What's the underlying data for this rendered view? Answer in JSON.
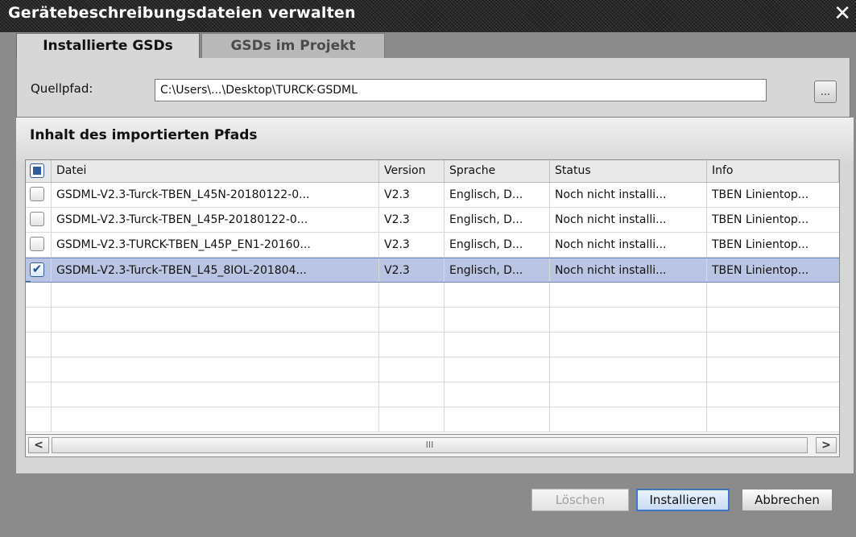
{
  "window": {
    "title": "Gerätebeschreibungsdateien verwalten",
    "close_glyph": "✕"
  },
  "tabs": [
    {
      "label": "Installierte GSDs",
      "active": true
    },
    {
      "label": "GSDs im Projekt",
      "active": false
    }
  ],
  "source": {
    "label": "Quellpfad:",
    "value": "C:\\Users\\...\\Desktop\\TURCK-GSDML",
    "browse_label": "..."
  },
  "section_title": "Inhalt des importierten Pfads",
  "table": {
    "columns": [
      "Datei",
      "Version",
      "Sprache",
      "Status",
      "Info"
    ],
    "rows": [
      {
        "checked": false,
        "file": "GSDML-V2.3-Turck-TBEN_L45N-20180122-0...",
        "version": "V2.3",
        "language": "Englisch, D...",
        "status": "Noch nicht installi...",
        "info": "TBEN Linientop..."
      },
      {
        "checked": false,
        "file": "GSDML-V2.3-Turck-TBEN_L45P-20180122-0...",
        "version": "V2.3",
        "language": "Englisch, D...",
        "status": "Noch nicht installi...",
        "info": "TBEN Linientop..."
      },
      {
        "checked": false,
        "file": "GSDML-V2.3-TURCK-TBEN_L45P_EN1-20160...",
        "version": "V2.3",
        "language": "Englisch, D...",
        "status": "Noch nicht installi...",
        "info": "TBEN Linientop..."
      },
      {
        "checked": true,
        "file": "GSDML-V2.3-Turck-TBEN_L45_8IOL-201804...",
        "version": "V2.3",
        "language": "Englisch, D...",
        "status": "Noch nicht installi...",
        "info": "TBEN Linientop..."
      }
    ],
    "empty_rows": 6
  },
  "scrollbar": {
    "left_glyph": "<",
    "right_glyph": ">",
    "thumb_glyph": "III"
  },
  "buttons": {
    "delete": "Löschen",
    "install": "Installieren",
    "cancel": "Abbrechen"
  },
  "colors": {
    "selection": "#b9c5e3",
    "accent": "#2e5d9f",
    "title_bar": "#1e1e1e"
  }
}
